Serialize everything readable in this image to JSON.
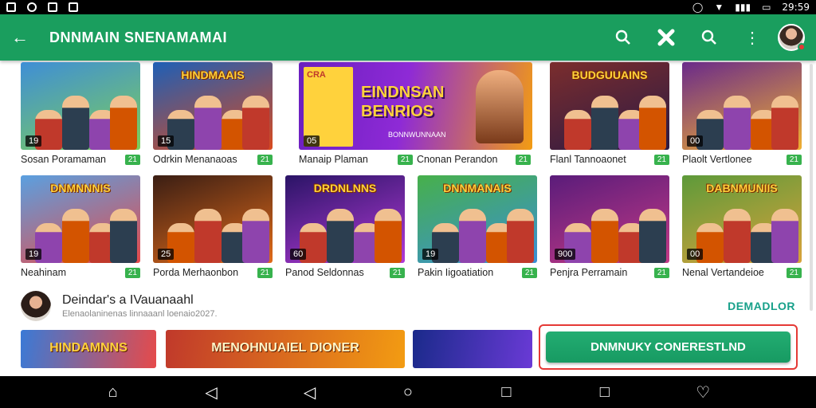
{
  "status": {
    "time": "29:59"
  },
  "appbar": {
    "title": "DNNMAIN SNENAMAMAI",
    "icons": [
      "back-arrow-icon",
      "search-icon",
      "close-icon",
      "search-icon",
      "more-vert-icon"
    ]
  },
  "cards": [
    {
      "name": "Sosan Poramaman",
      "num": "19",
      "tag": "",
      "badge": "21",
      "colors": [
        "#3f8ed6",
        "#7ccf5a"
      ]
    },
    {
      "name": "Odrkin Menanaoas",
      "num": "15",
      "tag": "",
      "banner": "HINDMAAIS",
      "badge": "21",
      "colors": [
        "#1e5fb6",
        "#d94a1e"
      ]
    },
    {
      "name": "Manaip Plaman",
      "num": "05",
      "tag": "",
      "badge": "21",
      "colors": [
        "#6a1fbf",
        "#f39c12"
      ]
    },
    {
      "name": "Cnonan Perandon",
      "num": "",
      "tag": "",
      "badge": "21",
      "colors": [
        "#7a1fbf",
        "#e67e22"
      ]
    },
    {
      "name": "Flanl Tannoaonet",
      "num": "",
      "tag": "",
      "banner": "BUDGUUAINS",
      "badge": "21",
      "colors": [
        "#7b2d2d",
        "#2b1a44"
      ]
    },
    {
      "name": "Plaolt Vertlonee",
      "num": "00",
      "tag": "",
      "badge": "21",
      "colors": [
        "#6a2a8a",
        "#f0b030"
      ]
    },
    {
      "name": "Neahinam",
      "num": "19",
      "tag": "",
      "banner": "DNMNNNIS",
      "badge": "21",
      "colors": [
        "#5aa0e0",
        "#e64a4a"
      ]
    },
    {
      "name": "Porda Merhaonbon",
      "num": "25",
      "tag": "",
      "badge": "21",
      "colors": [
        "#3a1e14",
        "#e06a1a"
      ]
    },
    {
      "name": "Panod Seldonnas",
      "num": "60",
      "tag": "",
      "banner": "DRDNLNNS",
      "badge": "21",
      "colors": [
        "#2a1466",
        "#b23ad6"
      ]
    },
    {
      "name": "Pakin Iigoatiation",
      "num": "19",
      "tag": "",
      "banner": "DNNMANAIS",
      "badge": "21",
      "colors": [
        "#47b04a",
        "#3a8fd6"
      ]
    },
    {
      "name": "Penjra Perramain",
      "num": "900",
      "tag": "",
      "badge": "21",
      "colors": [
        "#5a1c7a",
        "#c43a86"
      ]
    },
    {
      "name": "Nenal Vertandeioe",
      "num": "00",
      "tag": "",
      "banner": "DABNMUNIIS",
      "badge": "21",
      "colors": [
        "#5d9a3a",
        "#d9a23a"
      ]
    }
  ],
  "feature_card": {
    "title": "EINDNSAN BENRIOS",
    "sub": "BONNWUNNAAN",
    "num": "05",
    "corner": "CRA"
  },
  "creator": {
    "title": "Deindar's a IVauanaahl",
    "subtitle": "Elenaolaninenas linnaaanl loenaio2027.",
    "link": "DEMADLOR"
  },
  "strip": [
    {
      "text": "HINDAMNNS"
    },
    {
      "text": "MENOHNUAIEL DIONER"
    },
    {
      "text": ""
    }
  ],
  "cta": {
    "label": "DNMNUKY CONERESTLND"
  }
}
